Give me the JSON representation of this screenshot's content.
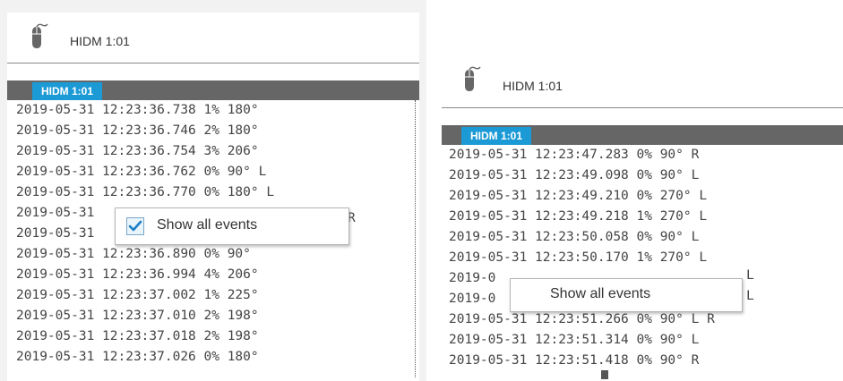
{
  "left": {
    "device_title": "HIDM 1:01",
    "tab_label": "HIDM 1:01",
    "events": [
      "2019-05-31 12:23:36.738 1% 180°",
      "2019-05-31 12:23:36.746 2% 180°",
      "2019-05-31 12:23:36.754 3% 206°",
      "2019-05-31 12:23:36.762 0% 90° L",
      "2019-05-31 12:23:36.770 0% 180° L",
      "2019-05-31",
      "2019-05-31",
      "2019-05-31 12:23:36.890 0% 90°",
      "2019-05-31 12:23:36.994 4% 206°",
      "2019-05-31 12:23:37.002 1% 225°",
      "2019-05-31 12:23:37.010 2% 198°",
      "2019-05-31 12:23:37.018 2% 198°",
      "2019-05-31 12:23:37.026 0% 180°"
    ],
    "behind_menu_fragment": "R",
    "context_menu": {
      "label": "Show all events",
      "checked": true
    }
  },
  "right": {
    "device_title": "HIDM 1:01",
    "tab_label": "HIDM 1:01",
    "events": [
      "2019-05-31 12:23:47.283 0% 90° R",
      "2019-05-31 12:23:49.098 0% 90° L",
      "2019-05-31 12:23:49.210 0% 270° L",
      "2019-05-31 12:23:49.218 1% 270° L",
      "2019-05-31 12:23:50.058 0% 90° L",
      "2019-05-31 12:23:50.170 1% 270° L",
      "2019-0",
      "2019-0",
      "2019-05-31 12:23:51.266 0% 90° L R",
      "2019-05-31 12:23:51.314 0% 90° L",
      "2019-05-31 12:23:51.418 0% 90° R"
    ],
    "behind_menu_fragments": [
      "L",
      "L"
    ],
    "context_menu": {
      "label": "Show all events",
      "checked": false
    }
  },
  "colors": {
    "tab_accent": "#1c9ad6",
    "tab_bar": "#666666",
    "text": "#444444"
  },
  "icons": {
    "device": "mouse-icon",
    "check": "check-icon"
  }
}
